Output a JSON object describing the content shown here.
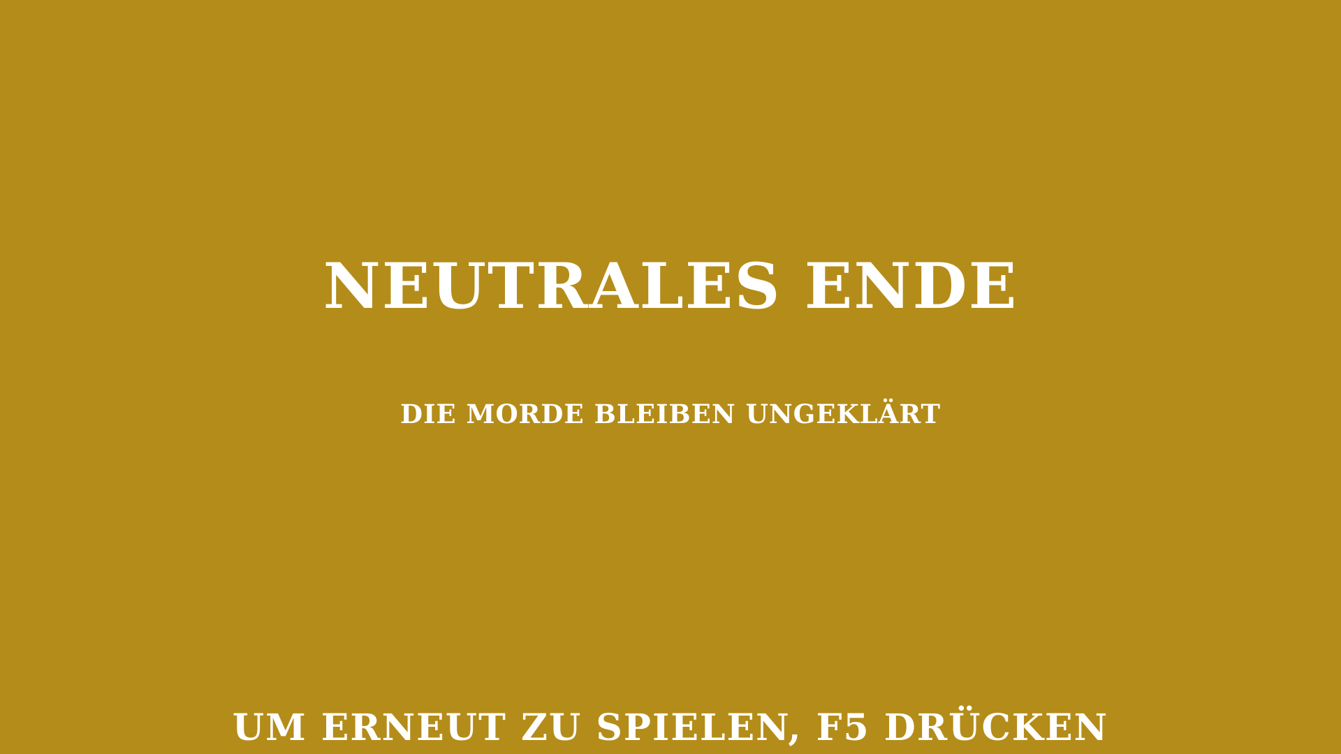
{
  "ending": {
    "title": "NEUTRALES ENDE",
    "subtitle": "DIE MORDE BLEIBEN UNGEKLÄRT"
  },
  "footer": {
    "restart_hint": "UM ERNEUT ZU SPIELEN, F5 DRÜCKEN"
  },
  "colors": {
    "background": "#b48c19",
    "text": "#ffffff"
  }
}
